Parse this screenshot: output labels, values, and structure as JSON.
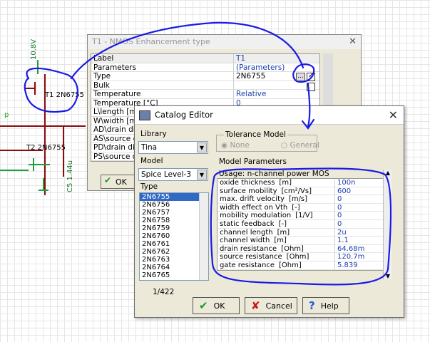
{
  "schematic": {
    "voltage_label": "10.8V",
    "t1_label": "T1 2N6755",
    "t2_label": "T2 2N6755",
    "cap_label": "C5 1.44u",
    "partial_label": "p"
  },
  "t1_dialog": {
    "title": "T1 - NMOS Enhancement type",
    "header": {
      "label": "Label",
      "value": "T1"
    },
    "rows": [
      {
        "key": "Parameters",
        "value": "(Parameters)"
      },
      {
        "key": "Type",
        "value": "2N6755"
      },
      {
        "key": "Bulk",
        "value": ""
      },
      {
        "key": "Temperature",
        "value": "Relative"
      },
      {
        "key": "Temperature [°C]",
        "value": "0"
      },
      {
        "key": "L\\length [m]",
        "value": ""
      },
      {
        "key": "W\\width [m]",
        "value": ""
      },
      {
        "key": "AD\\drain diff.",
        "value": ""
      },
      {
        "key": "AS\\source diff.",
        "value": ""
      },
      {
        "key": "PD\\drain diff.",
        "value": ""
      },
      {
        "key": "PS\\source diff.",
        "value": ""
      }
    ],
    "ellipsis_label": "...",
    "ok_label": "OK"
  },
  "catalog": {
    "title": "Catalog Editor",
    "library_label": "Library",
    "library_value": "Tina",
    "model_label": "Model",
    "model_value": "Spice Level-3",
    "type_label": "Type",
    "types": [
      "2N6755",
      "2N6756",
      "2N6757",
      "2N6758",
      "2N6759",
      "2N6760",
      "2N6761",
      "2N6762",
      "2N6763",
      "2N6764",
      "2N6765"
    ],
    "count": "1/422",
    "tolerance_title": "Tolerance Model",
    "tol_none": "None",
    "tol_general": "General",
    "model_params_label": "Model Parameters",
    "usage": "Usage: n-channel power MOS",
    "params": [
      {
        "name": "oxide thickness",
        "unit": "[m]",
        "value": "100n"
      },
      {
        "name": "surface mobility",
        "unit": "[cm²/Vs]",
        "value": "600"
      },
      {
        "name": "max. drift velocity",
        "unit": "[m/s]",
        "value": "0"
      },
      {
        "name": "width effect on Vth",
        "unit": "[-]",
        "value": "0"
      },
      {
        "name": "mobility modulation",
        "unit": "[1/V]",
        "value": "0"
      },
      {
        "name": "static feedback",
        "unit": "[-]",
        "value": "0"
      },
      {
        "name": "channel length",
        "unit": "[m]",
        "value": "2u"
      },
      {
        "name": "channel width",
        "unit": "[m]",
        "value": "1.1"
      },
      {
        "name": "drain resistance",
        "unit": "[Ohm]",
        "value": "64.68m"
      },
      {
        "name": "source resistance",
        "unit": "[Ohm]",
        "value": "120.7m"
      },
      {
        "name": "gate resistance",
        "unit": "[Ohm]",
        "value": "5.839"
      }
    ],
    "buttons": {
      "ok": "OK",
      "cancel": "Cancel",
      "help": "Help"
    }
  },
  "colors": {
    "annotation": "#1a1ae6",
    "wire": "#8a0c0c",
    "value_text": "#1f3fb0"
  }
}
